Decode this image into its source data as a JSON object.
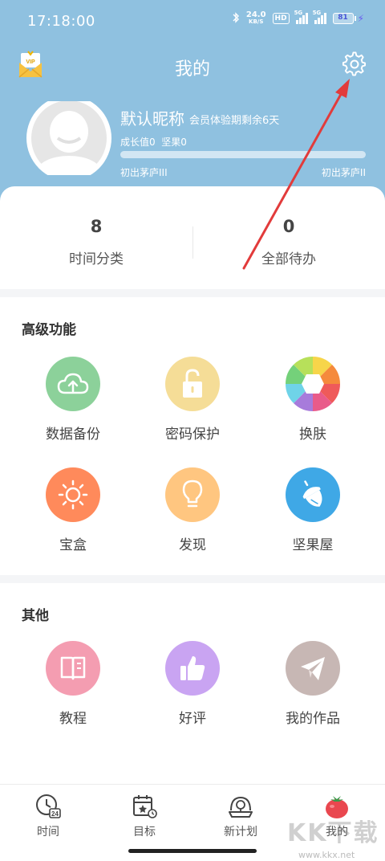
{
  "status": {
    "time": "17:18:00",
    "speed_value": "24.0",
    "speed_unit": "KB/S",
    "hd": "HD",
    "net1": "5G",
    "net2": "5G",
    "battery": "81"
  },
  "header": {
    "title": "我的"
  },
  "profile": {
    "nickname": "默认昵称",
    "member_info": "会员体验期剩余6天",
    "growth_text": "成长值0",
    "nuts_text": "坚果0",
    "level_current": "初出茅庐III",
    "level_next": "初出茅庐II",
    "progress": 0
  },
  "stats": [
    {
      "value": "8",
      "label": "时间分类"
    },
    {
      "value": "0",
      "label": "全部待办"
    }
  ],
  "advanced": {
    "title": "高级功能",
    "items": [
      {
        "label": "数据备份",
        "icon": "cloud-upload-icon",
        "color": "#8cd19a"
      },
      {
        "label": "密码保护",
        "icon": "unlock-icon",
        "color": "#f5dd97"
      },
      {
        "label": "换肤",
        "icon": "palette-icon",
        "color": "#ffffff"
      },
      {
        "label": "宝盒",
        "icon": "sun-icon",
        "color": "#ff8a5b"
      },
      {
        "label": "发现",
        "icon": "lightbulb-icon",
        "color": "#ffc680"
      },
      {
        "label": "坚果屋",
        "icon": "acorn-icon",
        "color": "#3fa8e6"
      }
    ]
  },
  "other": {
    "title": "其他",
    "items": [
      {
        "label": "教程",
        "icon": "book-icon",
        "color": "#f49db1"
      },
      {
        "label": "好评",
        "icon": "thumbs-up-icon",
        "color": "#c9a4f2"
      },
      {
        "label": "我的作品",
        "icon": "paper-plane-icon",
        "color": "#c7b7b4"
      }
    ]
  },
  "nav": [
    {
      "label": "时间",
      "icon": "clock-icon"
    },
    {
      "label": "目标",
      "icon": "calendar-star-icon"
    },
    {
      "label": "新计划",
      "icon": "plan-icon"
    },
    {
      "label": "我的",
      "icon": "tomato-icon"
    }
  ],
  "watermark": {
    "text": "KK下载",
    "url": "www.kkx.net"
  }
}
